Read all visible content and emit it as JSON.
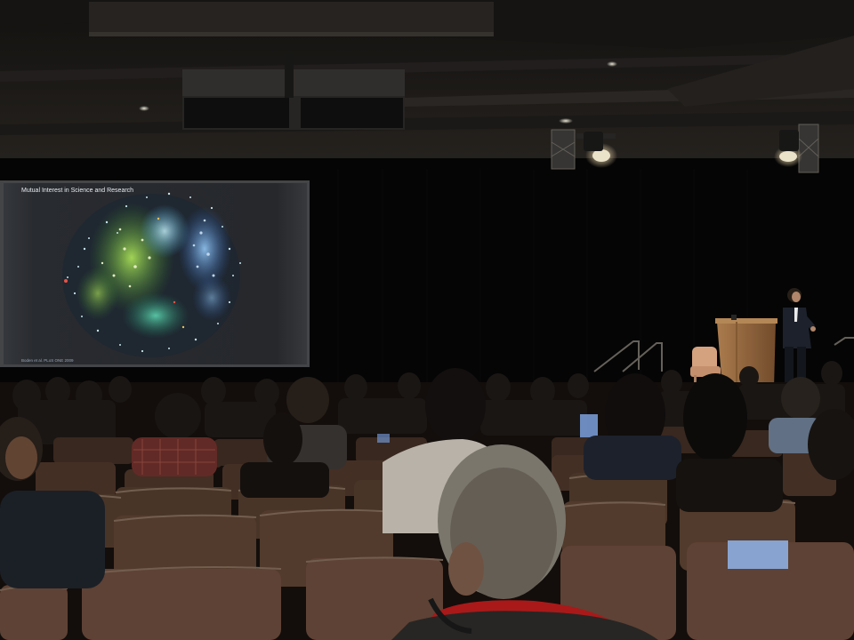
{
  "scene": {
    "description_tag": "conference talk",
    "palette": {
      "ceiling": "#1d1b19",
      "curtain": "#050505",
      "screen": "#2b2d31",
      "podium": "#9a6a3c",
      "chair": "#4a3428",
      "spotlight": "#fff6dc"
    }
  },
  "slide": {
    "title": "Mutual Interest in Science and Research",
    "citation": "Boden et al. PLoS ONE 2009"
  }
}
